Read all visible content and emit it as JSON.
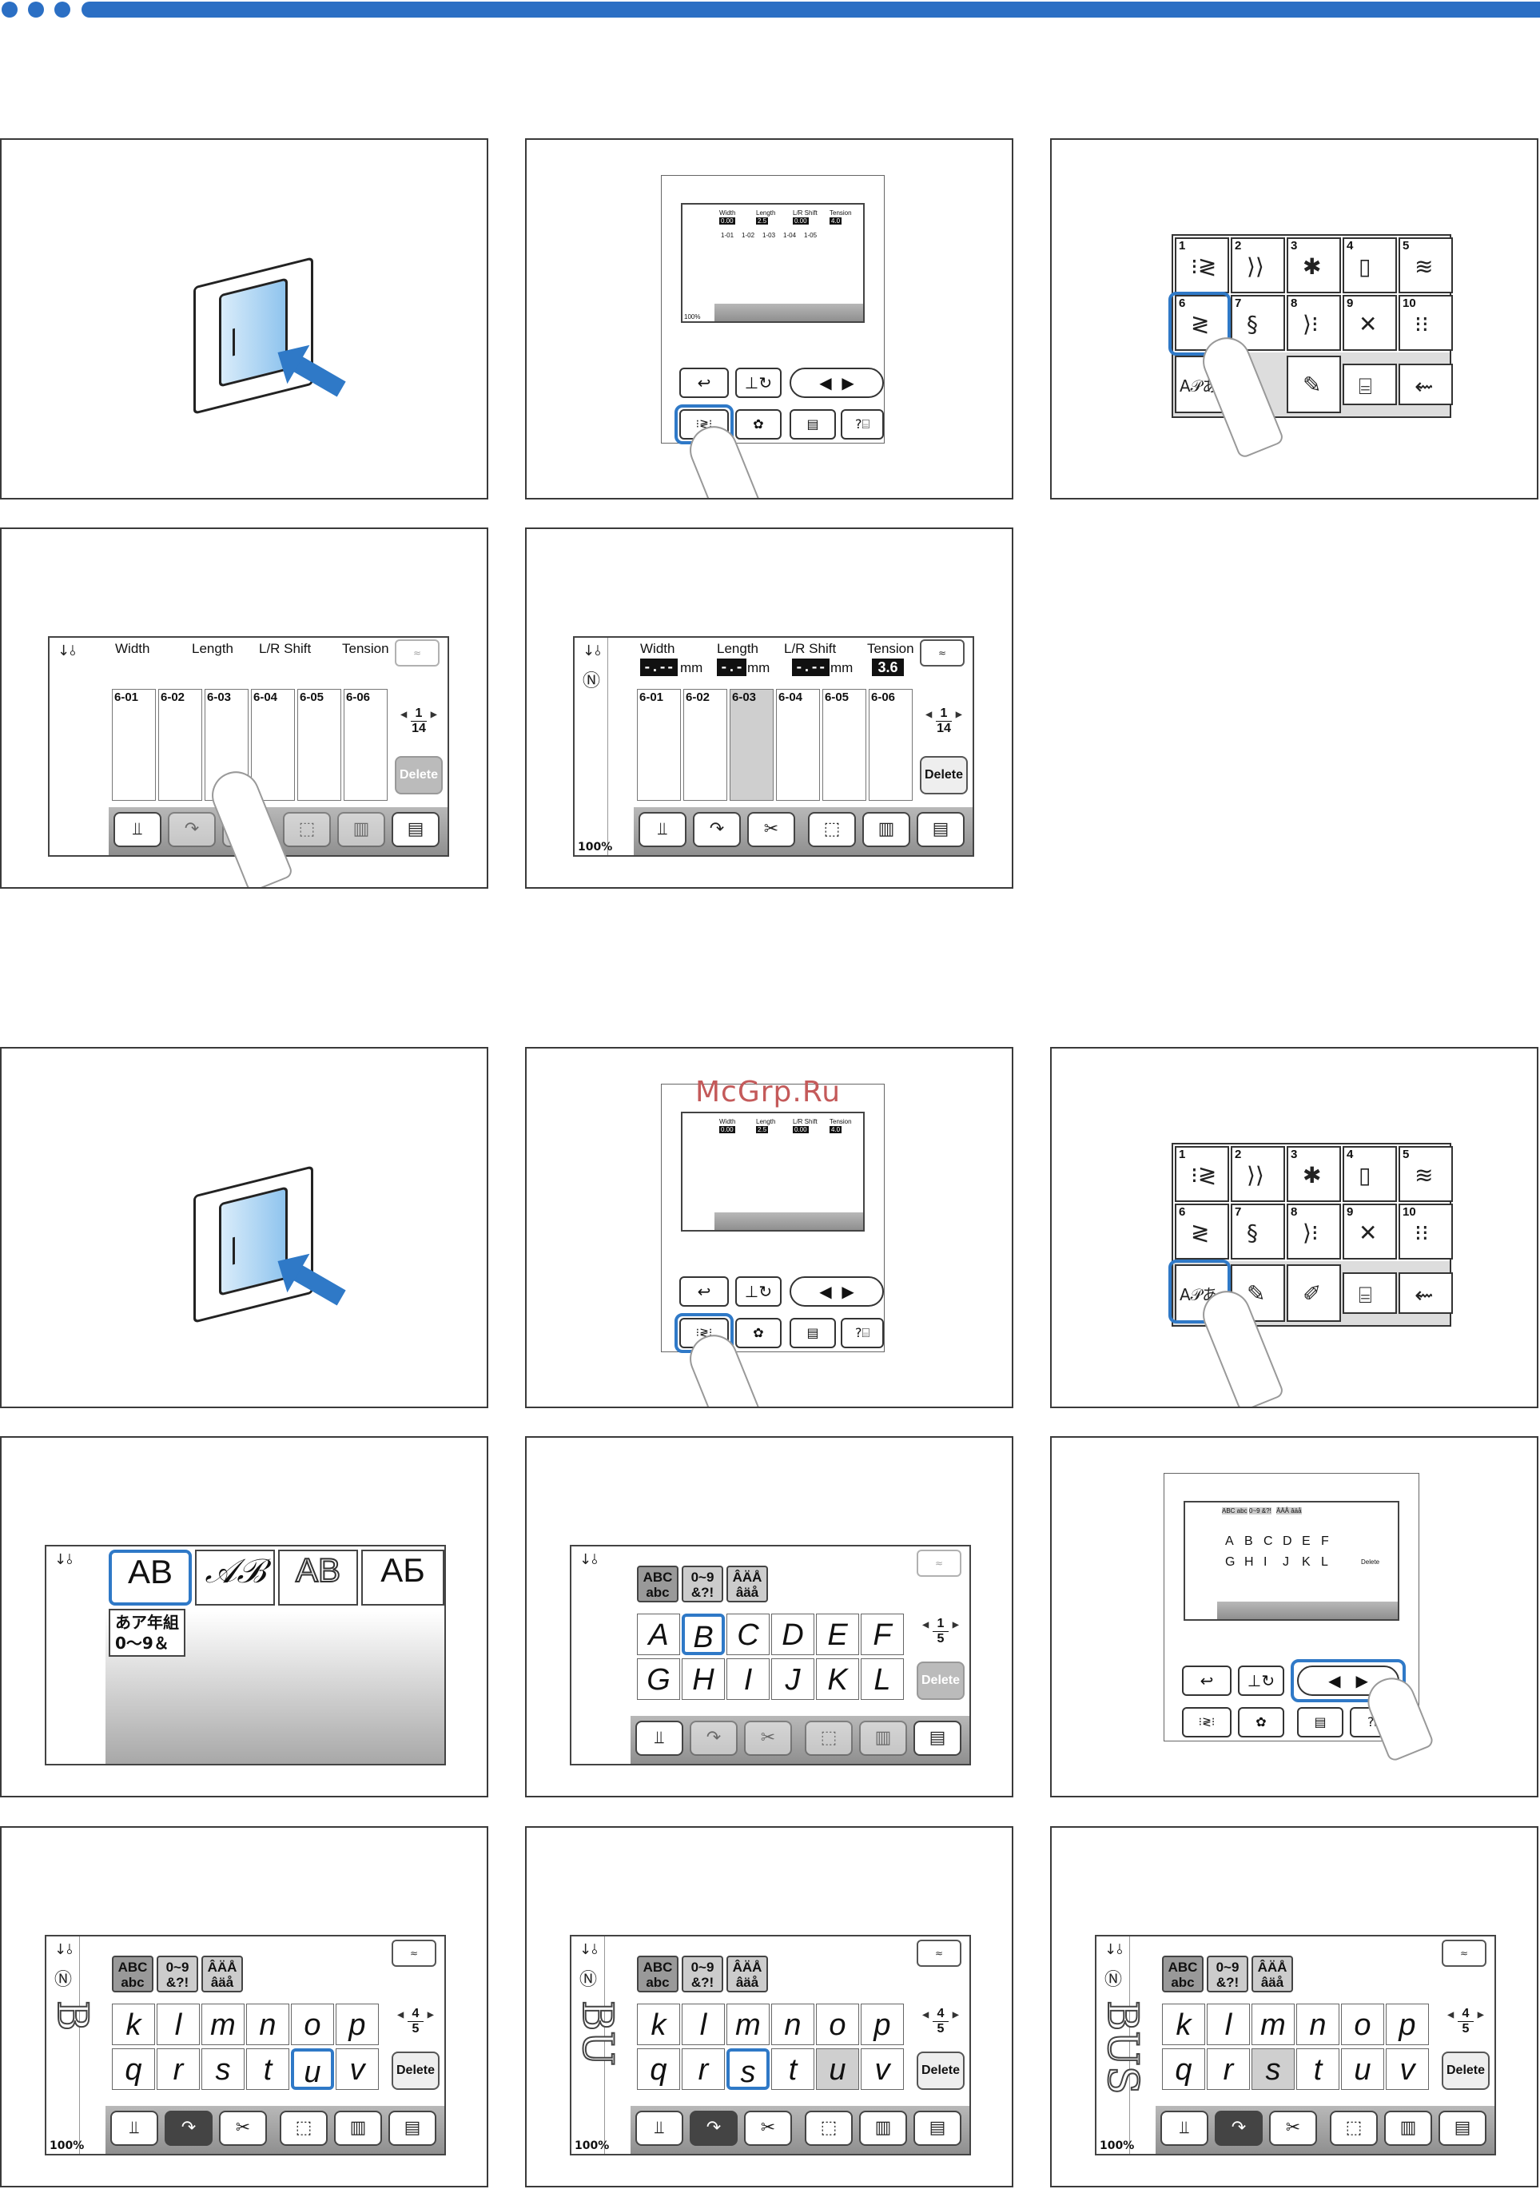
{
  "watermark": "McGrp.Ru",
  "colors": {
    "accent": "#2b6fc4",
    "highlight": "#2f79c7",
    "toolbar": "#9a9a9a"
  },
  "stitch_screen": {
    "labels": {
      "width": "Width",
      "length": "Length",
      "lr_shift": "L/R Shift",
      "tension": "Tension"
    },
    "unit": "mm",
    "tension_value": "3.6",
    "placeholder_value": "-.--",
    "placeholder_short": "-.-",
    "patterns": [
      "6-01",
      "6-02",
      "6-03",
      "6-04",
      "6-05",
      "6-06"
    ],
    "page_current": "1",
    "page_total": "14",
    "delete_label": "Delete",
    "zoom": "100%"
  },
  "home_screen": {
    "labels": {
      "width": "Width",
      "length": "Length",
      "lr_shift": "L/R Shift",
      "tension": "Tension"
    },
    "width_value": "0.00",
    "length_value": "2.5",
    "lr_value": "0.00",
    "tension_value": "4.0",
    "unit": "mm",
    "patterns": [
      "1-01",
      "1-02",
      "1-03",
      "1-04",
      "1-05"
    ],
    "zoom": "100%"
  },
  "category_screen": {
    "categories": [
      "1",
      "2",
      "3",
      "4",
      "5",
      "6",
      "7",
      "8",
      "9",
      "10"
    ],
    "char_button": "A𝒫あ"
  },
  "font_screen": {
    "fonts": [
      "AB",
      "𝒜ℬ",
      "AB",
      "АБ"
    ],
    "jp_line1": "あア年組",
    "jp_line2": "0～9＆"
  },
  "keyboard_upper": {
    "tabs": [
      "ABC abc",
      "0~9 &?!",
      "ÂÄÅ âäå"
    ],
    "row1": [
      "A",
      "B",
      "C",
      "D",
      "E",
      "F"
    ],
    "row2": [
      "G",
      "H",
      "I",
      "J",
      "K",
      "L"
    ],
    "page_current": "1",
    "page_total": "5",
    "delete_label": "Delete"
  },
  "keyboard_lower": {
    "tabs": [
      "ABC abc",
      "0~9 &?!",
      "ÂÄÅ âäå"
    ],
    "row1": [
      "k",
      "l",
      "m",
      "n",
      "o",
      "p"
    ],
    "row2": [
      "q",
      "r",
      "s",
      "t",
      "u",
      "v"
    ],
    "page_current": "4",
    "page_total": "5",
    "delete_label": "Delete",
    "zoom": "100%",
    "previews": [
      "B",
      "BU",
      "BUS"
    ]
  }
}
